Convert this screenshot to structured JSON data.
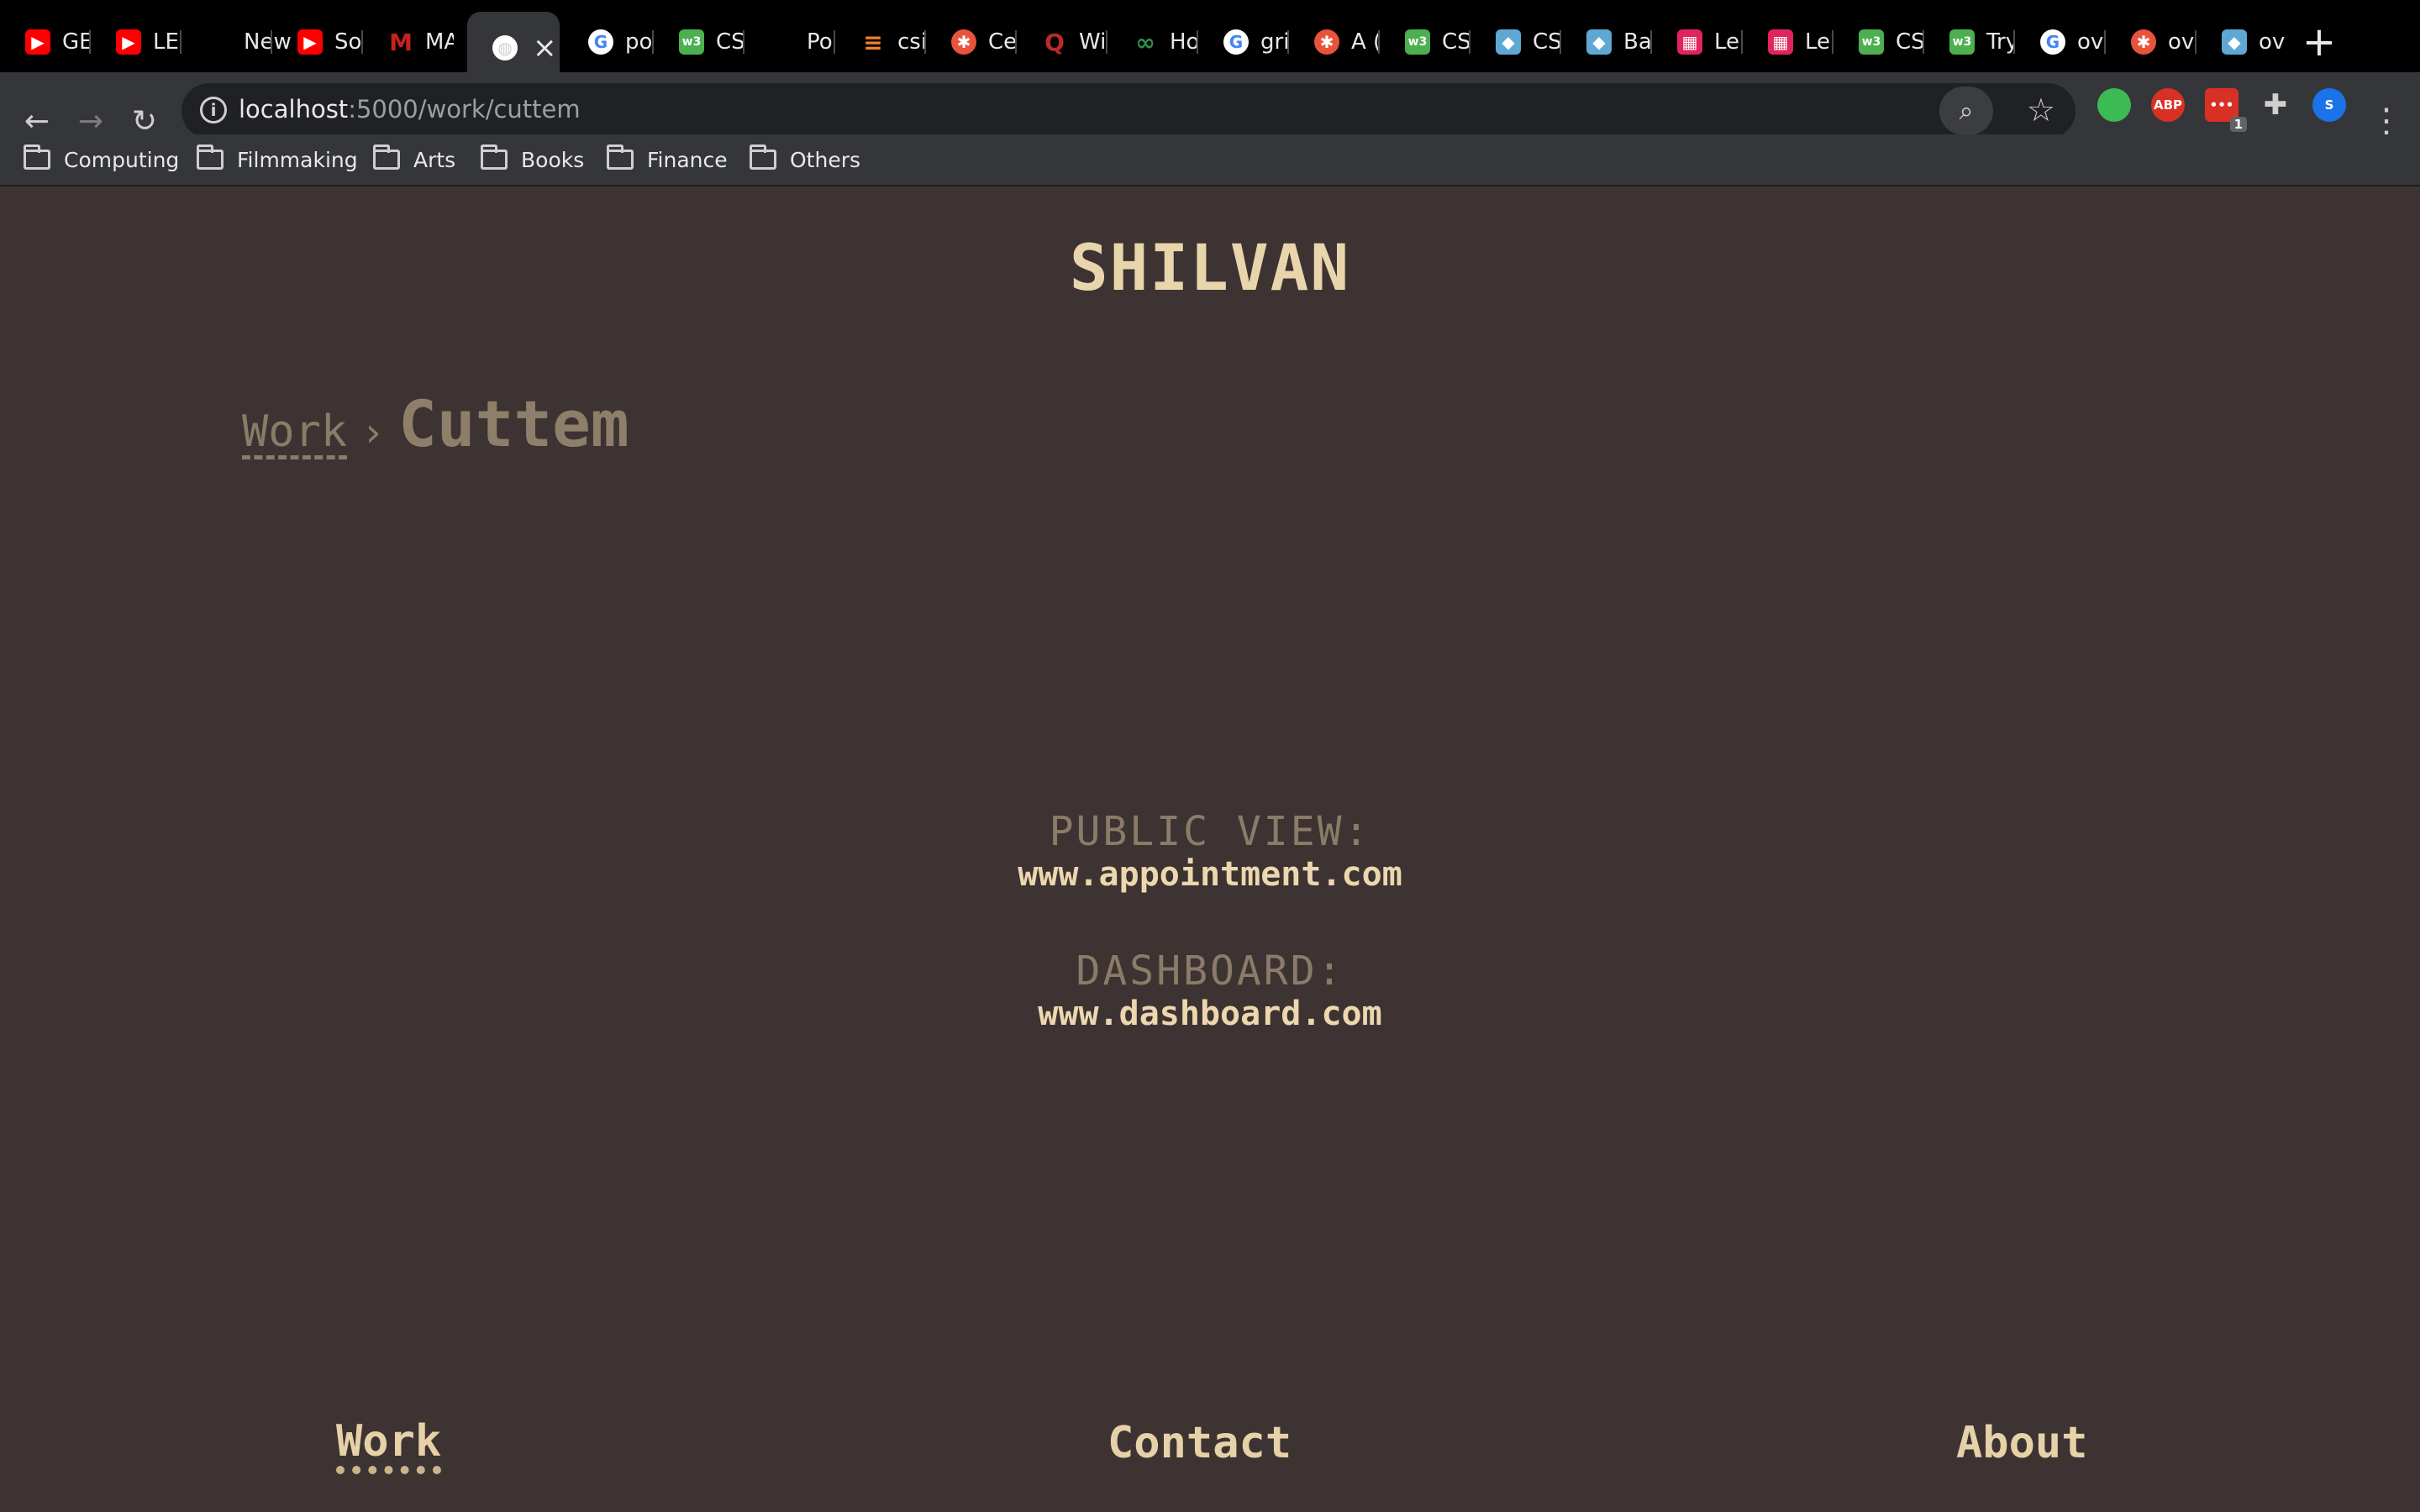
{
  "browser": {
    "tabs": [
      {
        "title": "GE",
        "icon": "youtube-icon",
        "color": "#ff0000"
      },
      {
        "title": "LE",
        "icon": "youtube-icon",
        "color": "#ff0000"
      },
      {
        "title": "New Ta",
        "icon": "none",
        "color": ""
      },
      {
        "title": "So",
        "icon": "youtube-icon",
        "color": "#ff0000"
      },
      {
        "title": "MA",
        "icon": "gmail-icon",
        "color": "#c5221f"
      },
      {
        "title": "",
        "icon": "globe-icon",
        "color": "#cfcfcf",
        "active": true
      },
      {
        "title": "po",
        "icon": "google-icon",
        "color": "#4285f4"
      },
      {
        "title": "CS",
        "icon": "w3schools-icon",
        "color": "#4caf50"
      },
      {
        "title": "Po",
        "icon": "none",
        "color": ""
      },
      {
        "title": "csi",
        "icon": "stackoverflow-icon",
        "color": "#f48024"
      },
      {
        "title": "Ce",
        "icon": "asterisk-icon",
        "color": "#e8533b"
      },
      {
        "title": "Wi",
        "icon": "quora-icon",
        "color": "#b92b27"
      },
      {
        "title": "Ho",
        "icon": "geeks-icon",
        "color": "#2f8d46"
      },
      {
        "title": "gri",
        "icon": "google-icon",
        "color": "#4285f4"
      },
      {
        "title": "A (",
        "icon": "asterisk-icon",
        "color": "#e8533b"
      },
      {
        "title": "CS",
        "icon": "w3schools-icon",
        "color": "#4caf50"
      },
      {
        "title": "CS",
        "icon": "cap-icon",
        "color": "#5fa8d3"
      },
      {
        "title": "Ba",
        "icon": "cap-icon",
        "color": "#5fa8d3"
      },
      {
        "title": "Le",
        "icon": "grid-icon",
        "color": "#e0245e"
      },
      {
        "title": "Le",
        "icon": "grid-icon",
        "color": "#e0245e"
      },
      {
        "title": "CS",
        "icon": "w3schools-icon",
        "color": "#4caf50"
      },
      {
        "title": "Try",
        "icon": "w3schools-icon",
        "color": "#4caf50"
      },
      {
        "title": "ov",
        "icon": "google-icon",
        "color": "#4285f4"
      },
      {
        "title": "ov",
        "icon": "asterisk-icon",
        "color": "#e8533b"
      },
      {
        "title": "ov",
        "icon": "cap-icon",
        "color": "#5fa8d3"
      }
    ],
    "address": {
      "host": "localhost",
      "rest": ":5000/work/cuttem"
    },
    "bookmarks": [
      "Computing",
      "Filmmaking",
      "Arts",
      "Books",
      "Finance",
      "Others"
    ],
    "extensions": [
      {
        "name": "green-extension-icon",
        "color": "#3cba54",
        "label": ""
      },
      {
        "name": "adblock-icon",
        "color": "#d93025",
        "label": "ABP"
      },
      {
        "name": "red-extension-icon",
        "color": "#d93025",
        "label": "•••",
        "badge": "1"
      },
      {
        "name": "puzzle-icon",
        "color": "",
        "label": ""
      },
      {
        "name": "profile-avatar",
        "color": "#1a73e8",
        "label": "S"
      }
    ]
  },
  "site": {
    "title": "SHILVAN",
    "breadcrumb": {
      "parent": "Work",
      "separator": "›",
      "current": "Cuttem"
    },
    "public_view": {
      "label": "PUBLIC VIEW:",
      "value": "www.appointment.com"
    },
    "dashboard": {
      "label": "DASHBOARD:",
      "value": "www.dashboard.com"
    },
    "nav": {
      "work": "Work",
      "contact": "Contact",
      "about": "About"
    }
  }
}
